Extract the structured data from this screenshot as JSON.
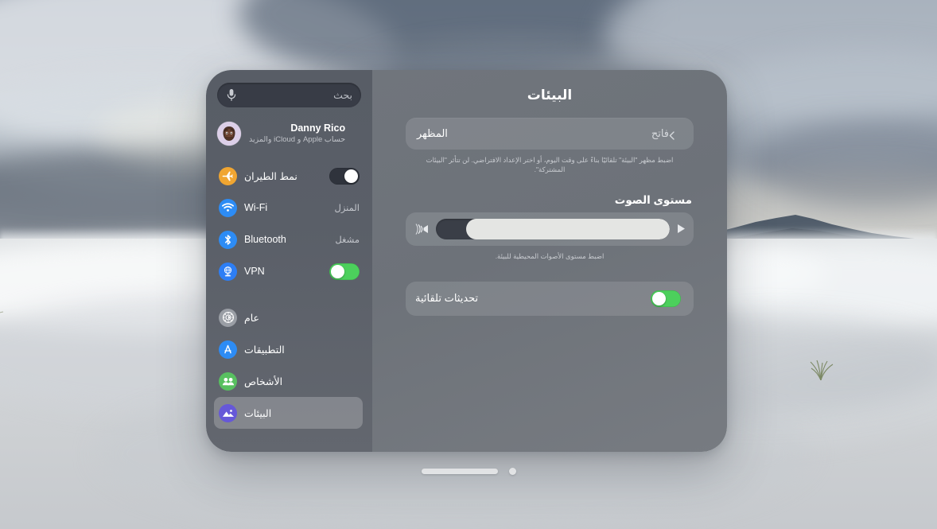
{
  "sidebar": {
    "search": {
      "placeholder": "بحث",
      "mic_icon": "microphone-icon"
    },
    "account": {
      "name": "Danny Rico",
      "subtitle": "حساب Apple و iCloud والمزيد",
      "avatar_icon": "memoji-avatar"
    },
    "connectivity": [
      {
        "label": "نمط الطيران",
        "icon": "airplane-icon",
        "icon_color": "#f0a531",
        "control": "toggle",
        "toggle_on": false
      },
      {
        "label": "Wi-Fi",
        "icon": "wifi-icon",
        "icon_color": "#2d8cf5",
        "control": "value",
        "value": "المنزل"
      },
      {
        "label": "Bluetooth",
        "icon": "bluetooth-icon",
        "icon_color": "#2d8cf5",
        "control": "value",
        "value": "مشغل"
      },
      {
        "label": "VPN",
        "icon": "vpn-globe-icon",
        "icon_color": "#2d7ef5",
        "control": "toggle",
        "toggle_on": true
      }
    ],
    "sections": [
      {
        "label": "عام",
        "icon": "gear-icon",
        "icon_color": "#9a9ea5",
        "selected": false
      },
      {
        "label": "التطبيقات",
        "icon": "app-store-icon",
        "icon_color": "#2d8cf5",
        "selected": false
      },
      {
        "label": "الأشخاص",
        "icon": "people-icon",
        "icon_color": "#58c060",
        "selected": false
      },
      {
        "label": "البيئات",
        "icon": "environments-mountain-icon",
        "icon_color": "#6658d8",
        "selected": true
      }
    ]
  },
  "detail": {
    "title": "البيئات",
    "appearance": {
      "label": "المظهر",
      "value": "فاتح",
      "chevron_icon": "chevron-left-icon"
    },
    "appearance_footnote": "اضبط مظهر \"البيئة\" تلقائيًا بناءً على وقت اليوم، أو اختر الإعداد الافتراضي. لن تتأثر \"البيئات المشتركة\".",
    "volume": {
      "section_title": "مستوى الصوت",
      "level_percent": 87,
      "speaker_icon": "speaker-waves-icon",
      "increase_icon": "triangle-right-icon",
      "footnote": "اضبط مستوى الأصوات المحيطية للبيئة."
    },
    "auto_updates": {
      "label": "تحديثات تلقائية",
      "toggle_on": true
    }
  },
  "home_indicator": {
    "bar_name": "home-bar",
    "dot_name": "page-dot"
  },
  "colors": {
    "toggle_on": "#4cd05c",
    "toggle_off": "#2f333c",
    "sidebar_bg": "#5a5f68",
    "detail_bg": "#6d7279",
    "selected_row": "rgba(255,255,255,0.22)"
  }
}
